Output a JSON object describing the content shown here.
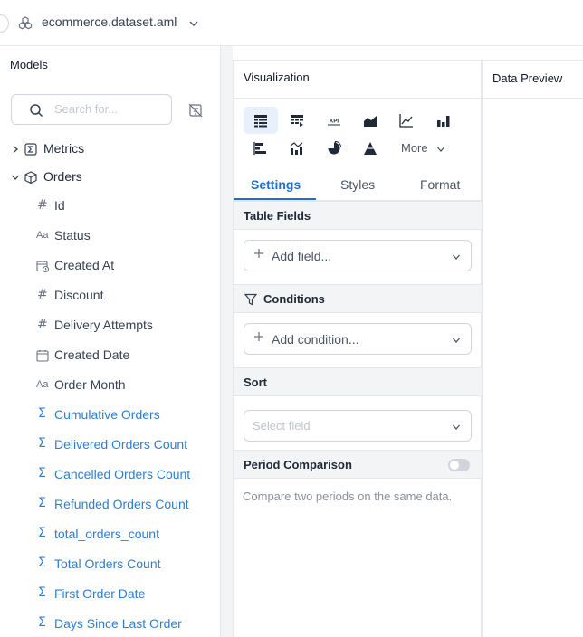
{
  "header": {
    "dataset_title": "ecommerce.dataset.aml",
    "dataset_icon": "dataset-icon",
    "chevron_icon": "chevron-down-icon"
  },
  "sidebar": {
    "title": "Models",
    "search_placeholder": "Search for...",
    "groups": [
      {
        "label": "Metrics",
        "icon": "metrics-icon",
        "expanded": false
      },
      {
        "label": "Orders",
        "icon": "cube-icon",
        "expanded": true
      }
    ],
    "fields": [
      {
        "label": "Id",
        "type": "number"
      },
      {
        "label": "Status",
        "type": "text"
      },
      {
        "label": "Created At",
        "type": "datetime"
      },
      {
        "label": "Discount",
        "type": "number"
      },
      {
        "label": "Delivery Attempts",
        "type": "number"
      },
      {
        "label": "Created Date",
        "type": "date"
      },
      {
        "label": "Order Month",
        "type": "text"
      },
      {
        "label": "Cumulative Orders",
        "type": "measure"
      },
      {
        "label": "Delivered Orders Count",
        "type": "measure"
      },
      {
        "label": "Cancelled Orders Count",
        "type": "measure"
      },
      {
        "label": "Refunded Orders Count",
        "type": "measure"
      },
      {
        "label": "total_orders_count",
        "type": "measure"
      },
      {
        "label": "Total Orders Count",
        "type": "measure"
      },
      {
        "label": "First Order Date",
        "type": "measure"
      },
      {
        "label": "Days Since Last Order",
        "type": "measure"
      }
    ]
  },
  "visualization": {
    "title": "Visualization",
    "more_label": "More",
    "tabs": [
      {
        "label": "Settings",
        "active": true
      },
      {
        "label": "Styles",
        "active": false
      },
      {
        "label": "Format",
        "active": false
      }
    ],
    "sections": {
      "table_fields": {
        "title": "Table Fields",
        "placeholder": "Add field..."
      },
      "conditions": {
        "title": "Conditions",
        "placeholder": "Add condition..."
      },
      "sort": {
        "title": "Sort",
        "placeholder": "Select field"
      },
      "period_comparison": {
        "title": "Period Comparison",
        "description": "Compare two periods on the same data.",
        "enabled": false
      }
    },
    "viz_types": [
      "table-icon",
      "pivot-table-icon",
      "kpi-icon",
      "area-chart-icon",
      "line-chart-icon",
      "bar-chart-icon",
      "horizontal-bar-icon",
      "combo-chart-icon",
      "pie-chart-icon",
      "pyramid-icon"
    ],
    "kpi_text": "KPI"
  },
  "data_preview": {
    "title": "Data Preview"
  },
  "colors": {
    "accent": "#1f6fd0",
    "measure": "#2f7dd2"
  }
}
